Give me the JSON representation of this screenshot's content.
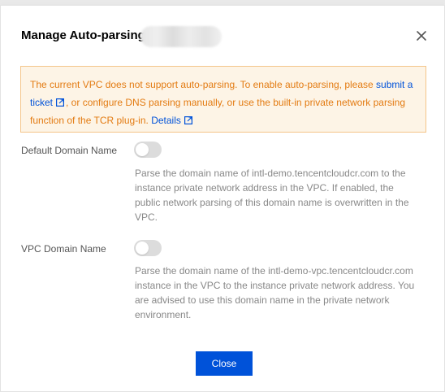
{
  "dialog": {
    "title": "Manage Auto-parsing",
    "close_icon": "close-icon"
  },
  "warning": {
    "text_before_link": "The current VPC does not support auto-parsing. To enable auto-parsing, please ",
    "submit_ticket_link": "submit a ticket",
    "text_middle": ", or configure DNS parsing manually, or use the built-in private network parsing function of the TCR plug-in. ",
    "details_link": "Details",
    "link_icon": "external-link-icon",
    "colors": {
      "background": "#fdf4e6",
      "border": "#f4c58a",
      "text": "#e37b12",
      "link": "#0052d9"
    }
  },
  "settings": [
    {
      "label": "Default Domain Name",
      "enabled": false,
      "description": "Parse the domain name of intl-demo.tencentcloudcr.com to the instance private network address in the VPC. If enabled, the public network parsing of this domain name is overwritten in the VPC."
    },
    {
      "label": "VPC Domain Name",
      "enabled": false,
      "description": "Parse the domain name of the intl-demo-vpc.tencentcloudcr.com instance in the VPC to the instance private network address. You are advised to use this domain name in the private network environment."
    }
  ],
  "footer": {
    "close_label": "Close",
    "primary_color": "#0052d9"
  }
}
